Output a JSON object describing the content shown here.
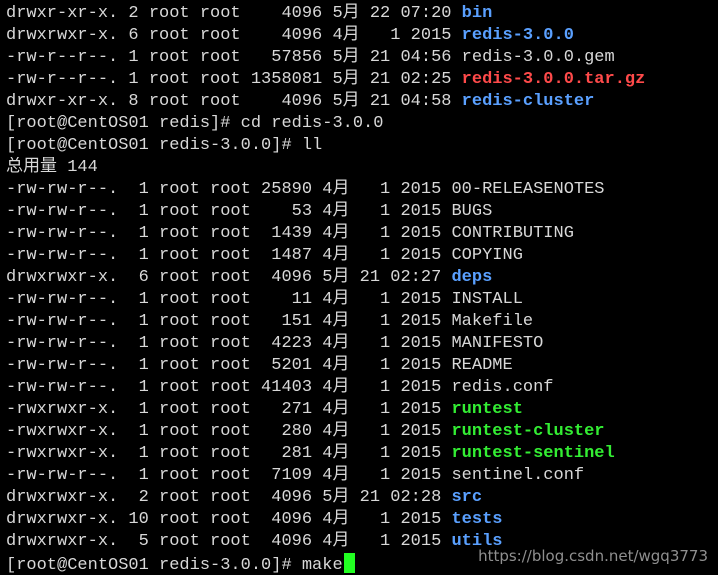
{
  "colors": {
    "background": "#000000",
    "text": "#d8d8d8",
    "directory": "#5aa0ff",
    "executable": "#33ee33",
    "archive": "#ff4a4a",
    "cursor": "#22ff22"
  },
  "listing_top": [
    {
      "perm": "drwxr-xr-x.",
      "links": "2",
      "owner": "root",
      "group": "root",
      "size": "4096",
      "month": "5月",
      "day": "22",
      "time": "07:20",
      "name": "bin",
      "kind": "dir"
    },
    {
      "perm": "drwxrwxr-x.",
      "links": "6",
      "owner": "root",
      "group": "root",
      "size": "4096",
      "month": "4月",
      "day": "1",
      "time": "2015",
      "name": "redis-3.0.0",
      "kind": "dir"
    },
    {
      "perm": "-rw-r--r--.",
      "links": "1",
      "owner": "root",
      "group": "root",
      "size": "57856",
      "month": "5月",
      "day": "21",
      "time": "04:56",
      "name": "redis-3.0.0.gem",
      "kind": "plain"
    },
    {
      "perm": "-rw-r--r--.",
      "links": "1",
      "owner": "root",
      "group": "root",
      "size": "1358081",
      "month": "5月",
      "day": "21",
      "time": "02:25",
      "name": "redis-3.0.0.tar.gz",
      "kind": "archive"
    },
    {
      "perm": "drwxr-xr-x.",
      "links": "8",
      "owner": "root",
      "group": "root",
      "size": "4096",
      "month": "5月",
      "day": "21",
      "time": "04:58",
      "name": "redis-cluster",
      "kind": "dir"
    }
  ],
  "cmd1": "[root@CentOS01 redis]# cd redis-3.0.0",
  "cmd2": "[root@CentOS01 redis-3.0.0]# ll",
  "total": "总用量 144",
  "listing_main": [
    {
      "perm": "-rw-rw-r--.",
      "links": "1",
      "owner": "root",
      "group": "root",
      "size": "25890",
      "month": "4月",
      "day": "1",
      "time": "2015",
      "name": "00-RELEASENOTES",
      "kind": "plain"
    },
    {
      "perm": "-rw-rw-r--.",
      "links": "1",
      "owner": "root",
      "group": "root",
      "size": "53",
      "month": "4月",
      "day": "1",
      "time": "2015",
      "name": "BUGS",
      "kind": "plain"
    },
    {
      "perm": "-rw-rw-r--.",
      "links": "1",
      "owner": "root",
      "group": "root",
      "size": "1439",
      "month": "4月",
      "day": "1",
      "time": "2015",
      "name": "CONTRIBUTING",
      "kind": "plain"
    },
    {
      "perm": "-rw-rw-r--.",
      "links": "1",
      "owner": "root",
      "group": "root",
      "size": "1487",
      "month": "4月",
      "day": "1",
      "time": "2015",
      "name": "COPYING",
      "kind": "plain"
    },
    {
      "perm": "drwxrwxr-x.",
      "links": "6",
      "owner": "root",
      "group": "root",
      "size": "4096",
      "month": "5月",
      "day": "21",
      "time": "02:27",
      "name": "deps",
      "kind": "dir"
    },
    {
      "perm": "-rw-rw-r--.",
      "links": "1",
      "owner": "root",
      "group": "root",
      "size": "11",
      "month": "4月",
      "day": "1",
      "time": "2015",
      "name": "INSTALL",
      "kind": "plain"
    },
    {
      "perm": "-rw-rw-r--.",
      "links": "1",
      "owner": "root",
      "group": "root",
      "size": "151",
      "month": "4月",
      "day": "1",
      "time": "2015",
      "name": "Makefile",
      "kind": "plain"
    },
    {
      "perm": "-rw-rw-r--.",
      "links": "1",
      "owner": "root",
      "group": "root",
      "size": "4223",
      "month": "4月",
      "day": "1",
      "time": "2015",
      "name": "MANIFESTO",
      "kind": "plain"
    },
    {
      "perm": "-rw-rw-r--.",
      "links": "1",
      "owner": "root",
      "group": "root",
      "size": "5201",
      "month": "4月",
      "day": "1",
      "time": "2015",
      "name": "README",
      "kind": "plain"
    },
    {
      "perm": "-rw-rw-r--.",
      "links": "1",
      "owner": "root",
      "group": "root",
      "size": "41403",
      "month": "4月",
      "day": "1",
      "time": "2015",
      "name": "redis.conf",
      "kind": "plain"
    },
    {
      "perm": "-rwxrwxr-x.",
      "links": "1",
      "owner": "root",
      "group": "root",
      "size": "271",
      "month": "4月",
      "day": "1",
      "time": "2015",
      "name": "runtest",
      "kind": "exec"
    },
    {
      "perm": "-rwxrwxr-x.",
      "links": "1",
      "owner": "root",
      "group": "root",
      "size": "280",
      "month": "4月",
      "day": "1",
      "time": "2015",
      "name": "runtest-cluster",
      "kind": "exec"
    },
    {
      "perm": "-rwxrwxr-x.",
      "links": "1",
      "owner": "root",
      "group": "root",
      "size": "281",
      "month": "4月",
      "day": "1",
      "time": "2015",
      "name": "runtest-sentinel",
      "kind": "exec"
    },
    {
      "perm": "-rw-rw-r--.",
      "links": "1",
      "owner": "root",
      "group": "root",
      "size": "7109",
      "month": "4月",
      "day": "1",
      "time": "2015",
      "name": "sentinel.conf",
      "kind": "plain"
    },
    {
      "perm": "drwxrwxr-x.",
      "links": "2",
      "owner": "root",
      "group": "root",
      "size": "4096",
      "month": "5月",
      "day": "21",
      "time": "02:28",
      "name": "src",
      "kind": "dir"
    },
    {
      "perm": "drwxrwxr-x.",
      "links": "10",
      "owner": "root",
      "group": "root",
      "size": "4096",
      "month": "4月",
      "day": "1",
      "time": "2015",
      "name": "tests",
      "kind": "dir"
    },
    {
      "perm": "drwxrwxr-x.",
      "links": "5",
      "owner": "root",
      "group": "root",
      "size": "4096",
      "month": "4月",
      "day": "1",
      "time": "2015",
      "name": "utils",
      "kind": "dir"
    }
  ],
  "prompt_final": "[root@CentOS01 redis-3.0.0]# ",
  "typed_command": "make",
  "watermark": "https://blog.csdn.net/wgq3773"
}
